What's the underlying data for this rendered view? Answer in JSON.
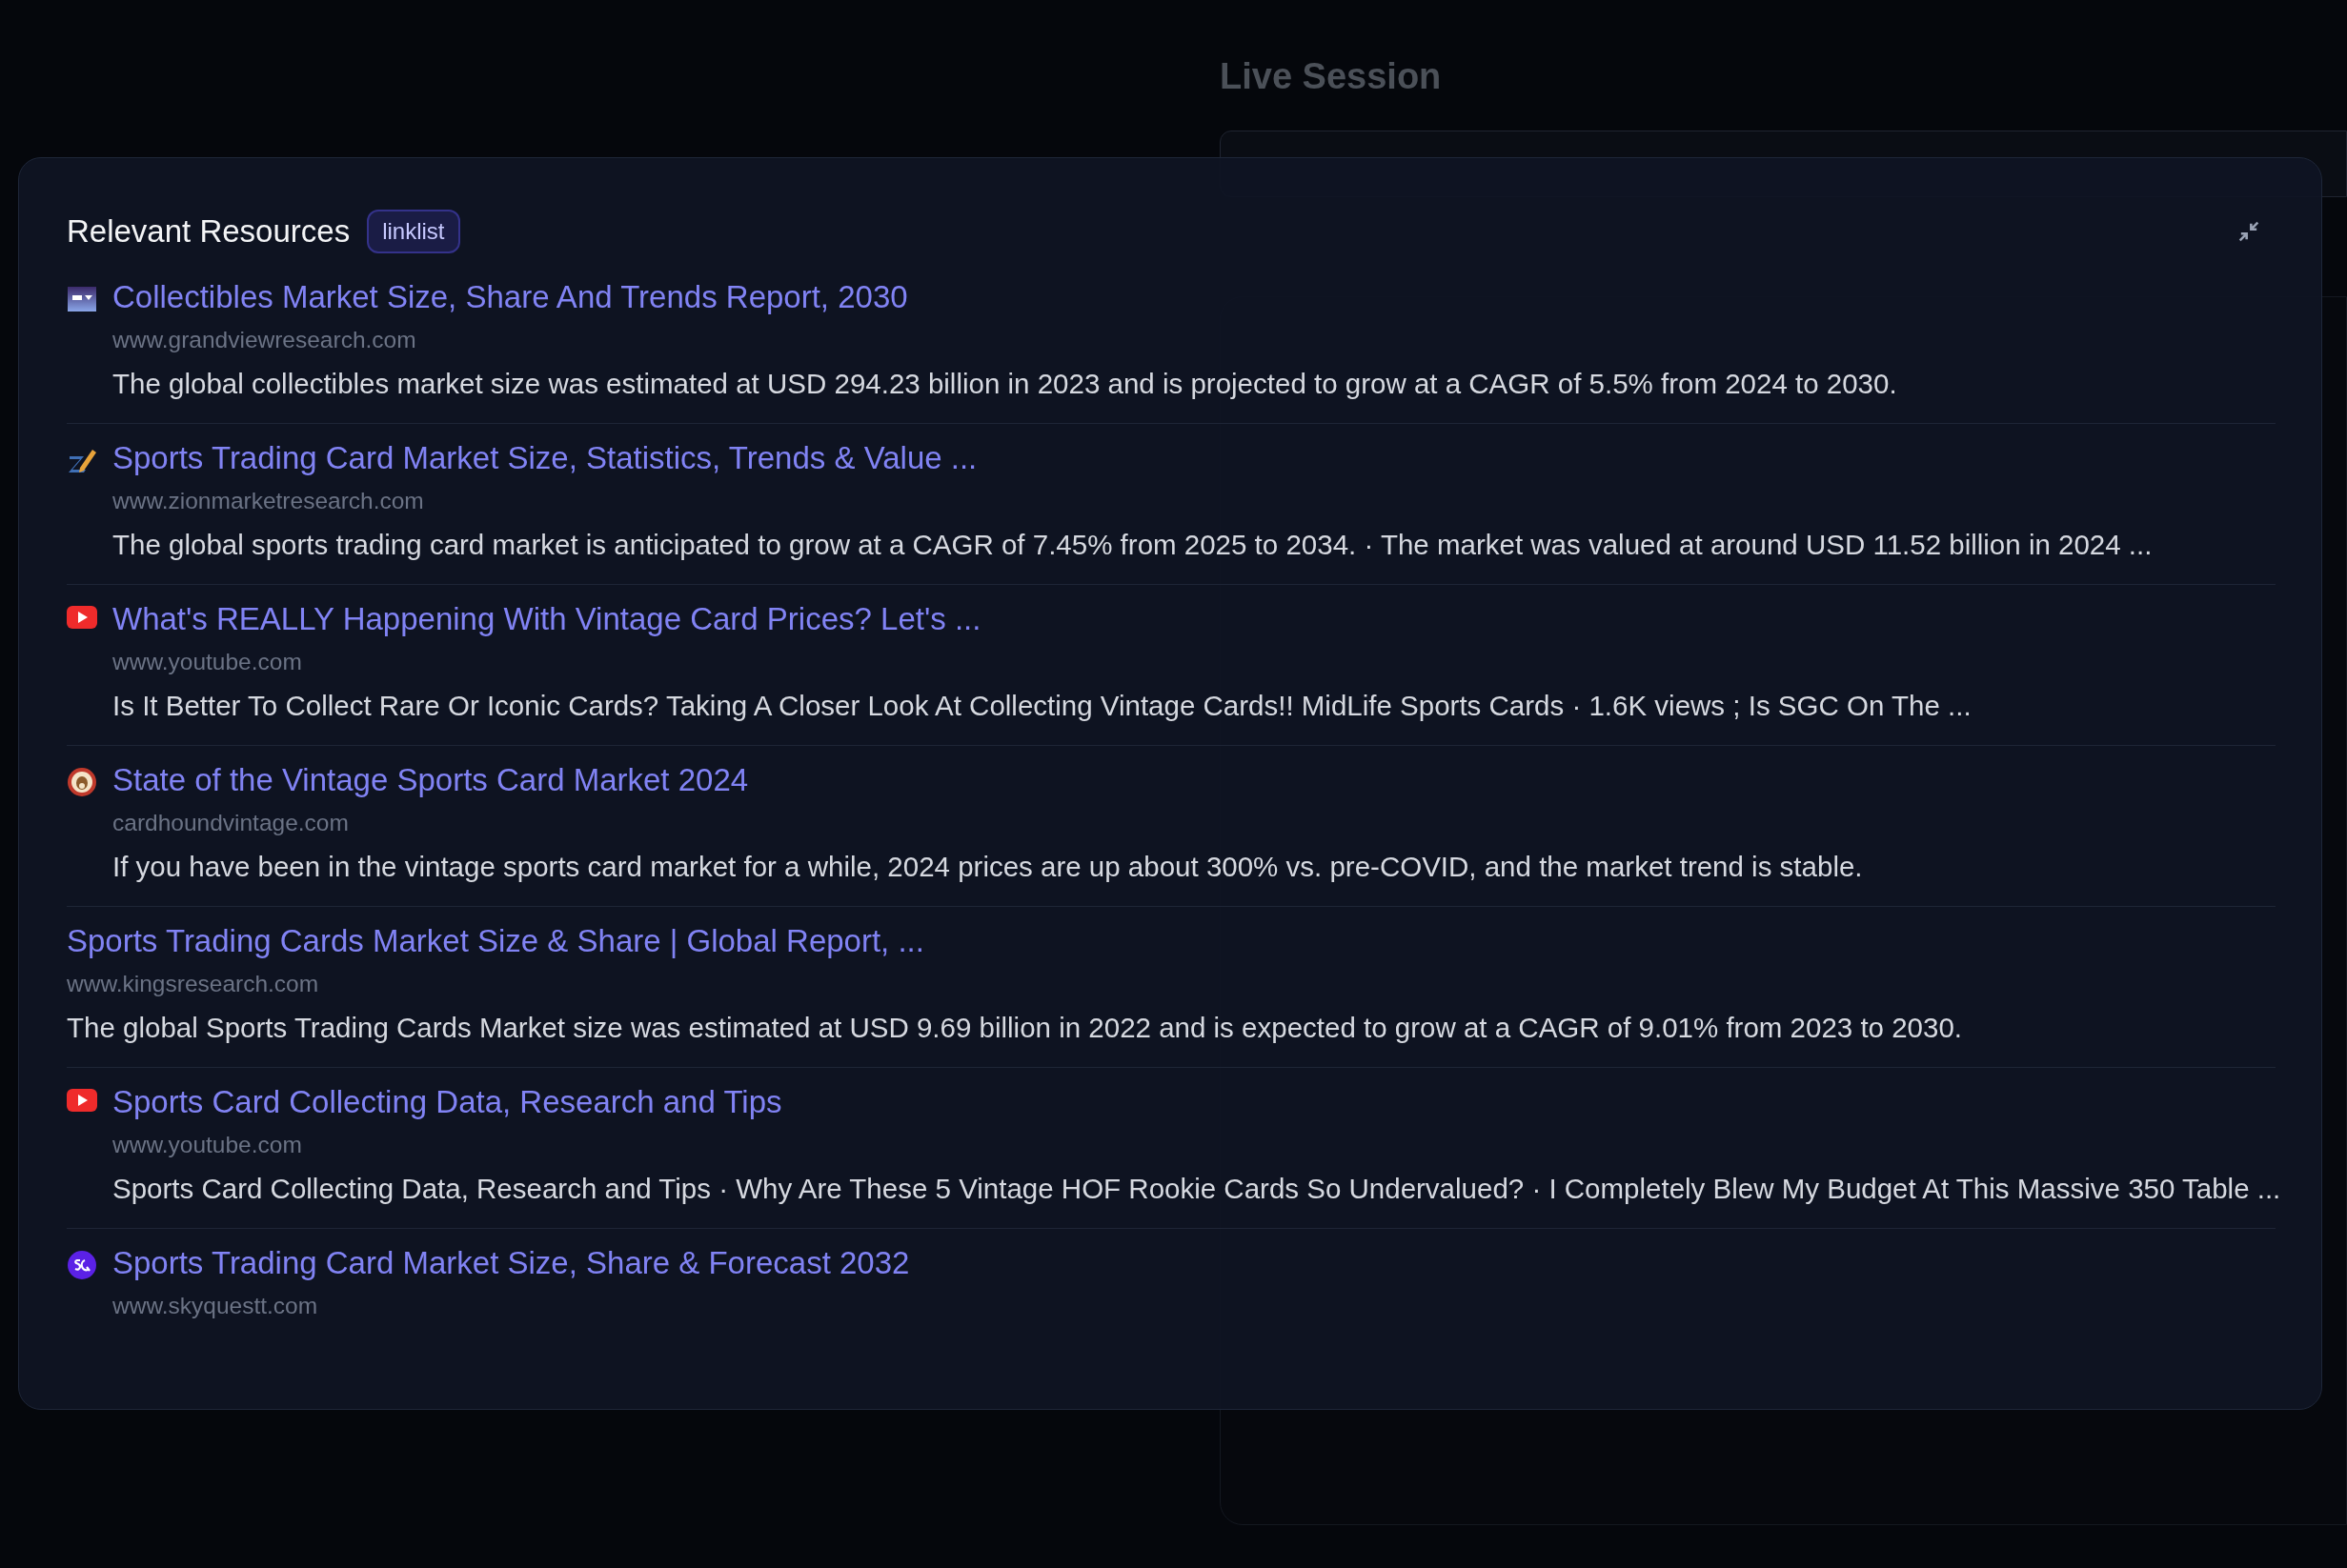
{
  "background": {
    "title": "Live Session"
  },
  "dialog": {
    "title": "Relevant Resources",
    "badge": "linklist",
    "resources": [
      {
        "kind": "window",
        "title": "Collectibles Market Size, Share And Trends Report, 2030",
        "domain": "www.grandviewresearch.com",
        "snippet": "The global collectibles market size was estimated at USD 294.23 billion in 2023 and is projected to grow at a CAGR of 5.5% from 2024 to 2030."
      },
      {
        "kind": "pencil",
        "title": "Sports Trading Card Market Size, Statistics, Trends & Value ...",
        "domain": "www.zionmarketresearch.com",
        "snippet": "The global sports trading card market is anticipated to grow at a CAGR of 7.45% from 2025 to 2034. · The market was valued at around USD 11.52 billion in 2024 ..."
      },
      {
        "kind": "play",
        "title": "What's REALLY Happening With Vintage Card Prices? Let's ...",
        "domain": "www.youtube.com",
        "snippet": "Is It Better To Collect Rare Or Iconic Cards? Taking A Closer Look At Collecting Vintage Cards!! MidLife Sports Cards · 1.6K views ; Is SGC On The ..."
      },
      {
        "kind": "dog",
        "title": "State of the Vintage Sports Card Market 2024",
        "domain": "cardhoundvintage.com",
        "snippet": "If you have been in the vintage sports card market for a while, 2024 prices are up about 300% vs. pre-COVID, and the market trend is stable."
      },
      {
        "title": "Sports Trading Cards Market Size & Share | Global Report, ...",
        "domain": "www.kingsresearch.com",
        "snippet": "The global Sports Trading Cards Market size was estimated at USD 9.69 billion in 2022 and is expected to grow at a CAGR of 9.01% from 2023 to 2030."
      },
      {
        "kind": "play",
        "title": "Sports Card Collecting Data, Research and Tips",
        "domain": "www.youtube.com",
        "snippet": "Sports Card Collecting Data, Research and Tips · Why Are These 5 Vintage HOF Rookie Cards So Undervalued? · I Completely Blew My Budget At This Massive 350 Table ..."
      },
      {
        "kind": "circle",
        "title": "Sports Trading Card Market Size, Share & Forecast 2032",
        "domain": "www.skyquestt.com"
      }
    ]
  }
}
